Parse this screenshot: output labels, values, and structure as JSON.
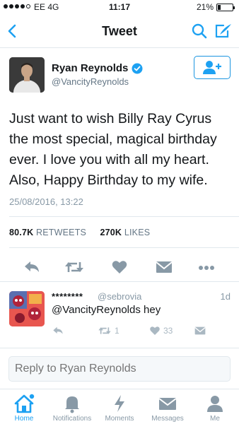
{
  "status_bar": {
    "carrier": "EE  4G",
    "time": "11:17",
    "battery": "21%",
    "battery_level": 0.21
  },
  "nav": {
    "title": "Tweet",
    "back_icon": "chevron-left-icon",
    "search_icon": "search-icon",
    "compose_icon": "compose-icon"
  },
  "tweet": {
    "author_name": "Ryan Reynolds",
    "author_handle": "@VancityReynolds",
    "text": "Just want to wish Billy Ray Cyrus the most special, magical birthday ever. I love you with all my heart. Also, Happy Birthday to my wife.",
    "timestamp": "25/08/2016, 13:22",
    "retweets_count": "80.7K",
    "retweets_label": "RETWEETS",
    "likes_count": "270K",
    "likes_label": "LIKES"
  },
  "reply": {
    "name": "********",
    "handle": "@sebrovia",
    "age": "1d",
    "text": "@VancityReynolds hey",
    "retweet_count": "1",
    "like_count": "33"
  },
  "reply_box": {
    "placeholder": "Reply to Ryan Reynolds"
  },
  "tabs": [
    {
      "label": "Home",
      "icon": "home-icon",
      "active": true
    },
    {
      "label": "Notifications",
      "icon": "bell-icon",
      "active": false
    },
    {
      "label": "Moments",
      "icon": "lightning-icon",
      "active": false
    },
    {
      "label": "Messages",
      "icon": "envelope-icon",
      "active": false
    },
    {
      "label": "Me",
      "icon": "person-icon",
      "active": false
    }
  ],
  "colors": {
    "accent": "#1da1f2",
    "text": "#14171a",
    "muted": "#8899a6",
    "border": "#e1e8ed"
  }
}
